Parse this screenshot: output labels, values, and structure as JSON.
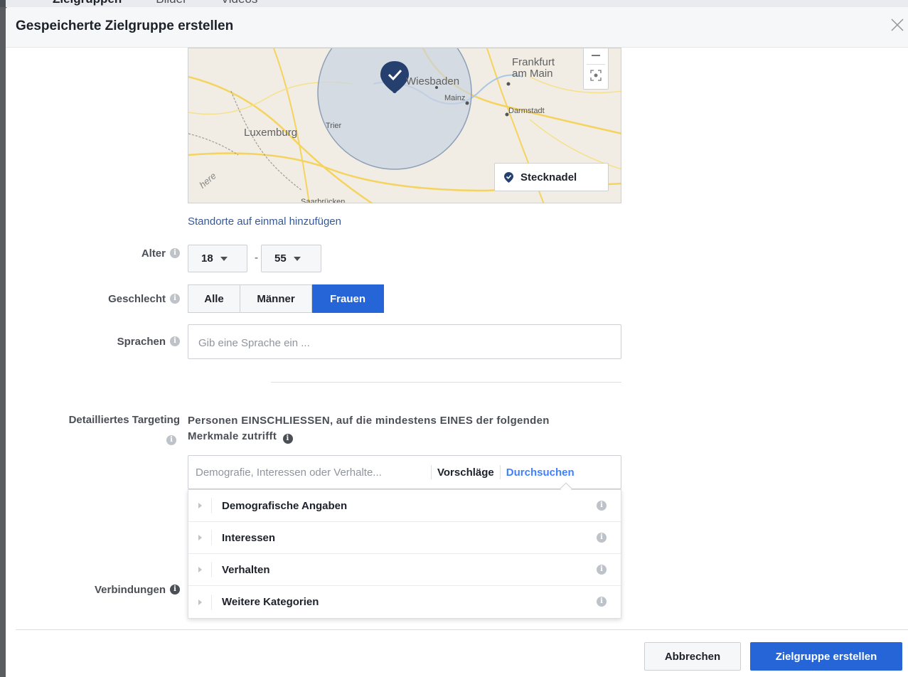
{
  "background_tabs": [
    "Zielgruppen",
    "Bilder",
    "Videos"
  ],
  "dialog": {
    "title": "Gespeicherte Zielgruppe erstellen"
  },
  "map": {
    "cities": {
      "frankfurt": "Frankfurt",
      "am_main": "am Main",
      "wiesbaden": "Wiesbaden",
      "mainz": "Mainz",
      "darmstadt": "Darmstadt",
      "luxemburg": "Luxemburg",
      "trier": "Trier",
      "saarbruecken": "Saarbrücken"
    },
    "attribution": "here",
    "pin_button_label": "Stecknadel",
    "pin_color": "#253f6e",
    "radius_fill": "#c9d3e1"
  },
  "locations": {
    "add_link": "Standorte auf einmal hinzufügen"
  },
  "age": {
    "label": "Alter",
    "min": "18",
    "max": "55",
    "separator": "-"
  },
  "gender": {
    "label": "Geschlecht",
    "options": [
      "Alle",
      "Männer",
      "Frauen"
    ],
    "selected": "Frauen"
  },
  "languages": {
    "label": "Sprachen",
    "placeholder": "Gib eine Sprache ein ..."
  },
  "detailed_targeting": {
    "label": "Detailliertes Targeting",
    "description": "Personen EINSCHLIESSEN, auf die mindestens EINES der folgenden Merkmale zutrifft",
    "placeholder": "Demografie, Interessen oder Verhalte...",
    "suggestions": "Vorschläge",
    "browse": "Durchsuchen",
    "categories": [
      "Demografische Angaben",
      "Interessen",
      "Verhalten",
      "Weitere Kategorien"
    ]
  },
  "connections": {
    "label": "Verbindungen"
  },
  "footer": {
    "cancel": "Abbrechen",
    "create": "Zielgruppe erstellen"
  },
  "colors": {
    "primary": "#2565d8",
    "link": "#365899"
  }
}
